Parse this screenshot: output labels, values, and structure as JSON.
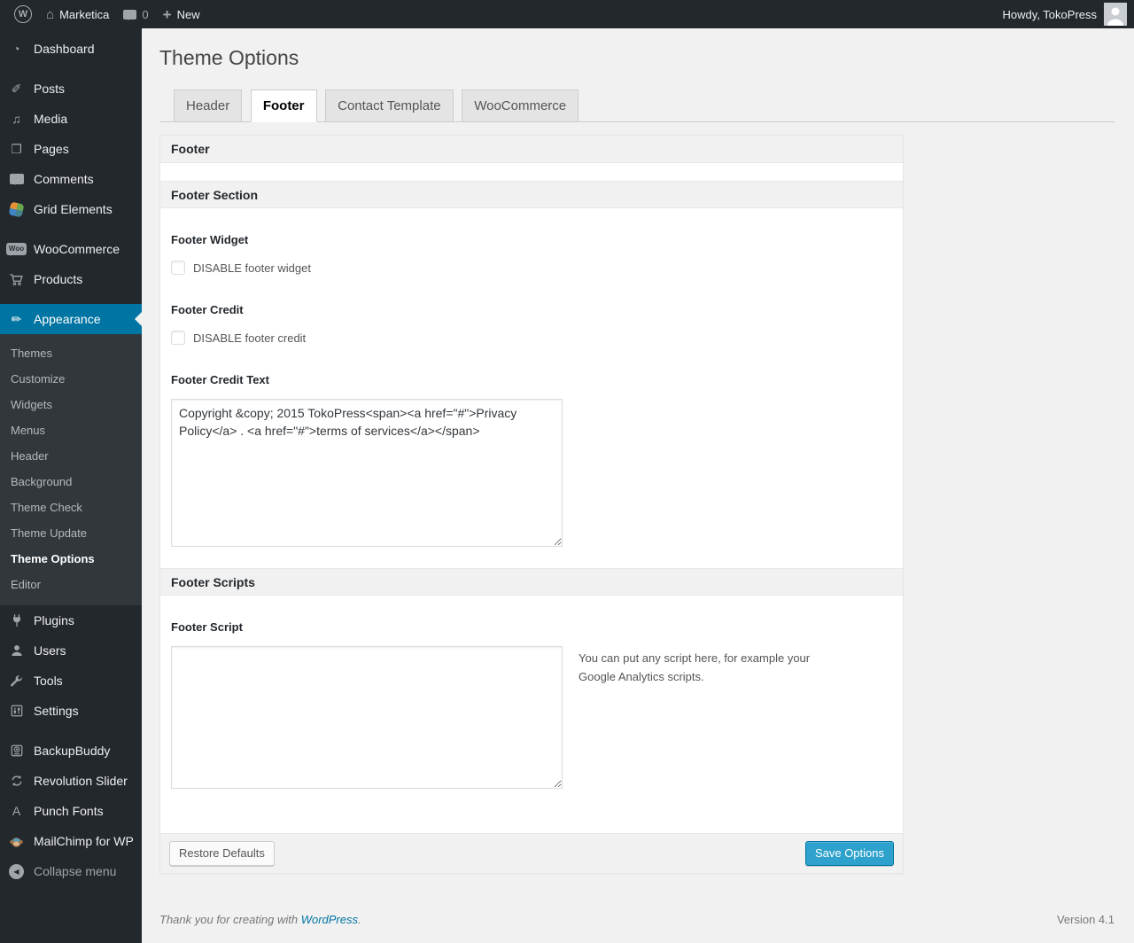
{
  "admin_bar": {
    "site_name": "Marketica",
    "comment_count": "0",
    "new_label": "New",
    "howdy_text": "Howdy, TokoPress"
  },
  "sidebar": {
    "top_items": [
      {
        "label": "Dashboard",
        "icon": "dashboard-icon",
        "glyph": "◔"
      },
      {
        "label": "Posts",
        "icon": "pushpin-icon",
        "glyph": "✐"
      },
      {
        "label": "Media",
        "icon": "media-icon",
        "glyph": "♫"
      },
      {
        "label": "Pages",
        "icon": "pages-icon",
        "glyph": "❐"
      },
      {
        "label": "Comments",
        "icon": "comments-icon"
      },
      {
        "label": "Grid Elements",
        "icon": "grid-elements-icon"
      },
      {
        "label": "WooCommerce",
        "icon": "woocommerce-icon",
        "glyph": "Woo"
      },
      {
        "label": "Products",
        "icon": "cart-icon"
      }
    ],
    "appearance_item": {
      "label": "Appearance",
      "icon": "brush-icon",
      "glyph": "✏"
    },
    "appearance_submenu": [
      {
        "label": "Themes"
      },
      {
        "label": "Customize"
      },
      {
        "label": "Widgets"
      },
      {
        "label": "Menus"
      },
      {
        "label": "Header"
      },
      {
        "label": "Background"
      },
      {
        "label": "Theme Check"
      },
      {
        "label": "Theme Update"
      },
      {
        "label": "Theme Options"
      },
      {
        "label": "Editor"
      }
    ],
    "bottom_items": [
      {
        "label": "Plugins",
        "icon": "plugin-icon"
      },
      {
        "label": "Users",
        "icon": "users-icon"
      },
      {
        "label": "Tools",
        "icon": "wrench-icon"
      },
      {
        "label": "Settings",
        "icon": "settings-icon"
      },
      {
        "label": "BackupBuddy",
        "icon": "backup-icon"
      },
      {
        "label": "Revolution Slider",
        "icon": "refresh-icon"
      },
      {
        "label": "Punch Fonts",
        "icon": "font-icon",
        "glyph": "A"
      },
      {
        "label": "MailChimp for WP",
        "icon": "mailchimp-icon"
      }
    ],
    "collapse_label": "Collapse menu"
  },
  "main": {
    "page_title": "Theme Options",
    "tabs": [
      {
        "label": "Header"
      },
      {
        "label": "Footer"
      },
      {
        "label": "Contact Template"
      },
      {
        "label": "WooCommerce"
      }
    ],
    "panel": {
      "box_title": "Footer",
      "section1_title": "Footer Section",
      "footer_widget_label": "Footer Widget",
      "footer_widget_checkbox_label": "DISABLE footer widget",
      "footer_credit_label": "Footer Credit",
      "footer_credit_checkbox_label": "DISABLE footer credit",
      "footer_credit_text_label": "Footer Credit Text",
      "footer_credit_text_value": "Copyright &copy; 2015 TokoPress<span><a href=\"#\">Privacy Policy</a> . <a href=\"#\">terms of services</a></span>",
      "section2_title": "Footer Scripts",
      "footer_script_label": "Footer Script",
      "footer_script_value": "",
      "footer_script_help": "You can put any script here, for example your Google Analytics scripts.",
      "restore_button": "Restore Defaults",
      "save_button": "Save Options"
    }
  },
  "page_footer": {
    "thanks_prefix": "Thank you for creating with ",
    "wordpress_link_label": "WordPress",
    "thanks_suffix": ".",
    "version": "Version 4.1"
  },
  "colors": {
    "admin_bar_bg": "#23282d",
    "submenu_bg": "#32373c",
    "menu_highlight": "#0074a2",
    "primary_button_bg": "#2ea2cc",
    "primary_button_border": "#0074a2",
    "link_blue": "#0074a2",
    "page_bg": "#f1f1f1"
  }
}
